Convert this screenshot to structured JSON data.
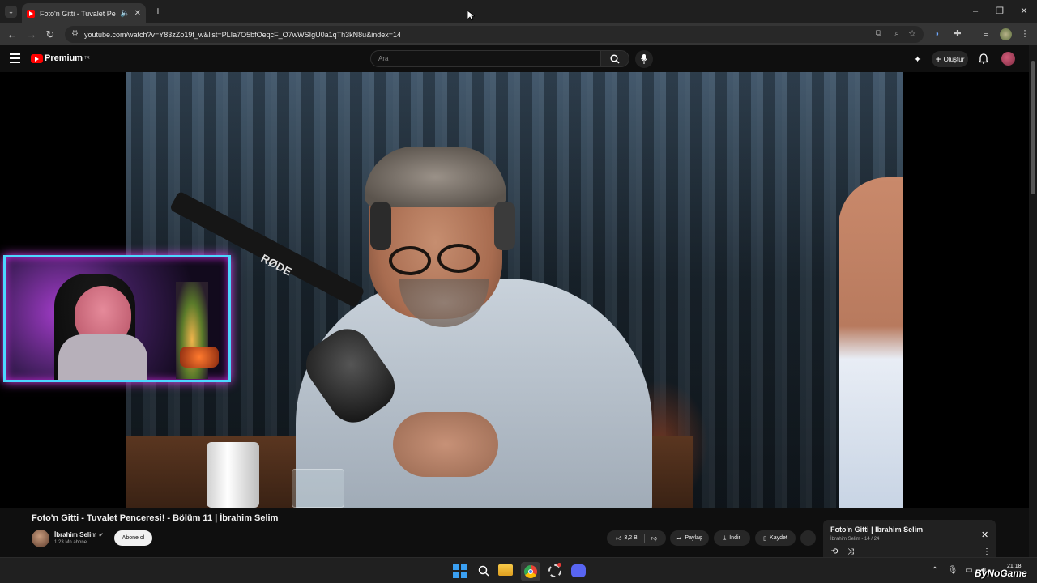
{
  "browser": {
    "tab_title": "Foto'n Gitti - Tuvalet Pencer",
    "url": "youtube.com/watch?v=Y83zZo19f_w&list=PLIa7O5bfOeqcF_O7wWSIgU0a1qTh3kN8u&index=14"
  },
  "youtube": {
    "logo_text": "Premium",
    "logo_badge": "TR",
    "search_placeholder": "Ara",
    "create_label": "Oluştur"
  },
  "video": {
    "title": "Foto'n Gitti - Tuvalet Penceresi! - Bölüm 11 | İbrahim Selim",
    "channel_name": "İbrahim Selim",
    "subscribers": "1,23 Mn abone",
    "subscribe_label": "Abone ol",
    "like_count": "3,2 B",
    "share_label": "Paylaş",
    "download_label": "İndir",
    "save_label": "Kaydet"
  },
  "playlist": {
    "title": "Foto'n Gitti | İbrahim Selim",
    "channel": "İbrahim Selim",
    "position": "14 / 24"
  },
  "taskbar": {
    "time": "21:18",
    "watermark": "ByNoGame"
  },
  "colors": {
    "yt_red": "#ff0000",
    "webcam_border": "#4cd7ff",
    "webcam_glow": "#d946ef"
  }
}
